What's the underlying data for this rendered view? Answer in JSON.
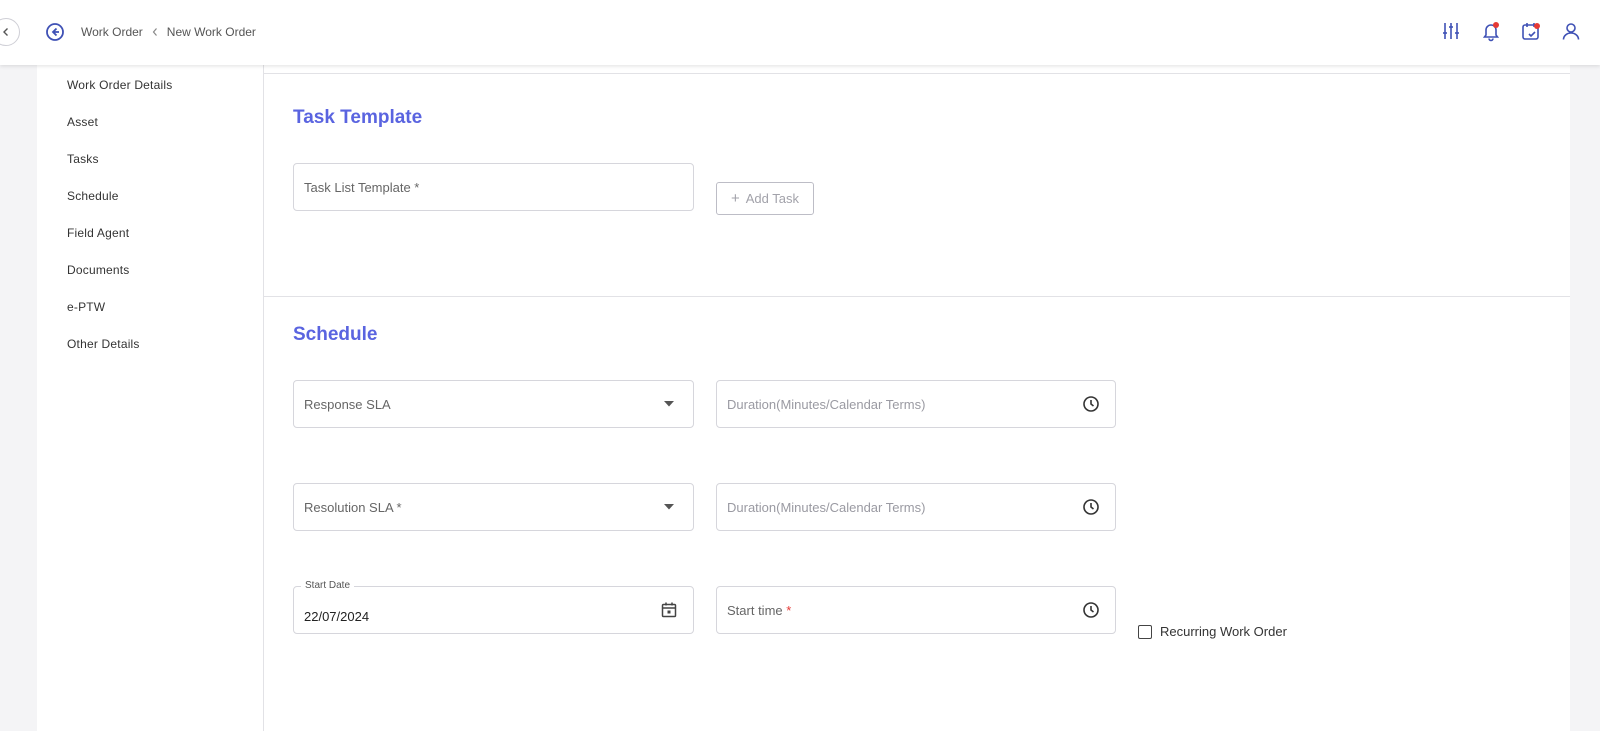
{
  "header": {
    "breadcrumb": {
      "parent": "Work Order",
      "current": "New Work Order"
    },
    "icons": [
      "filter-sliders-icon",
      "notification-bell-icon",
      "calendar-check-icon",
      "user-profile-icon"
    ]
  },
  "sidebar": {
    "items": [
      {
        "label": "Work Order Details"
      },
      {
        "label": "Asset"
      },
      {
        "label": "Tasks"
      },
      {
        "label": "Schedule"
      },
      {
        "label": "Field Agent"
      },
      {
        "label": "Documents"
      },
      {
        "label": "e-PTW"
      },
      {
        "label": "Other Details"
      }
    ]
  },
  "task_template": {
    "title": "Task Template",
    "task_list_template": {
      "label": "Task List Template *"
    },
    "add_task_label": "Add Task"
  },
  "schedule": {
    "title": "Schedule",
    "response_sla": {
      "label": "Response SLA"
    },
    "response_duration": {
      "placeholder": "Duration(Minutes/Calendar Terms)"
    },
    "resolution_sla": {
      "label": "Resolution SLA *"
    },
    "resolution_duration": {
      "placeholder": "Duration(Minutes/Calendar Terms)"
    },
    "start_date": {
      "label": "Start Date",
      "value": "22/07/2024"
    },
    "start_time": {
      "label": "Start time",
      "required_mark": "*"
    },
    "recurring": {
      "label": "Recurring Work Order",
      "checked": false
    }
  },
  "colors": {
    "accent": "#5a64e0",
    "required": "#e53935",
    "notification_dot": "#e53935"
  }
}
